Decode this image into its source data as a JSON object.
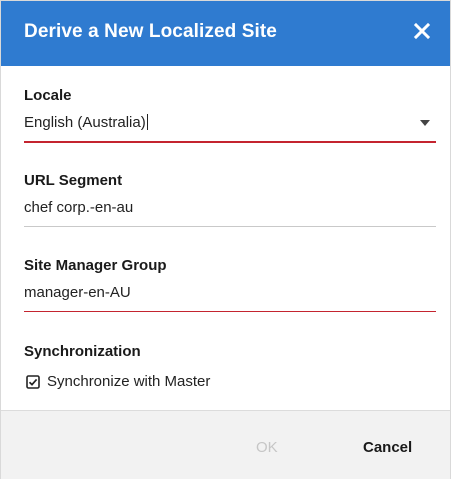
{
  "dialog": {
    "title": "Derive a New Localized Site",
    "header_color": "#2f7bd0",
    "close_icon": "close-icon"
  },
  "locale": {
    "label": "Locale",
    "value": "English (Australia)",
    "dropdown_icon": "chevron-down-icon",
    "focused": true
  },
  "url_segment": {
    "label": "URL Segment",
    "value": "chef corp.-en-au"
  },
  "site_manager_group": {
    "label": "Site Manager Group",
    "value": "manager-en-AU",
    "invalid": true
  },
  "synchronization": {
    "label": "Synchronization",
    "checkbox_label": "Synchronize with Master",
    "checked": true
  },
  "footer": {
    "ok_label": "OK",
    "ok_disabled": true,
    "cancel_label": "Cancel"
  },
  "colors": {
    "accent_red": "#c4242f",
    "disabled_text": "#c6c6c6",
    "footer_bg": "#f2f2f2"
  }
}
